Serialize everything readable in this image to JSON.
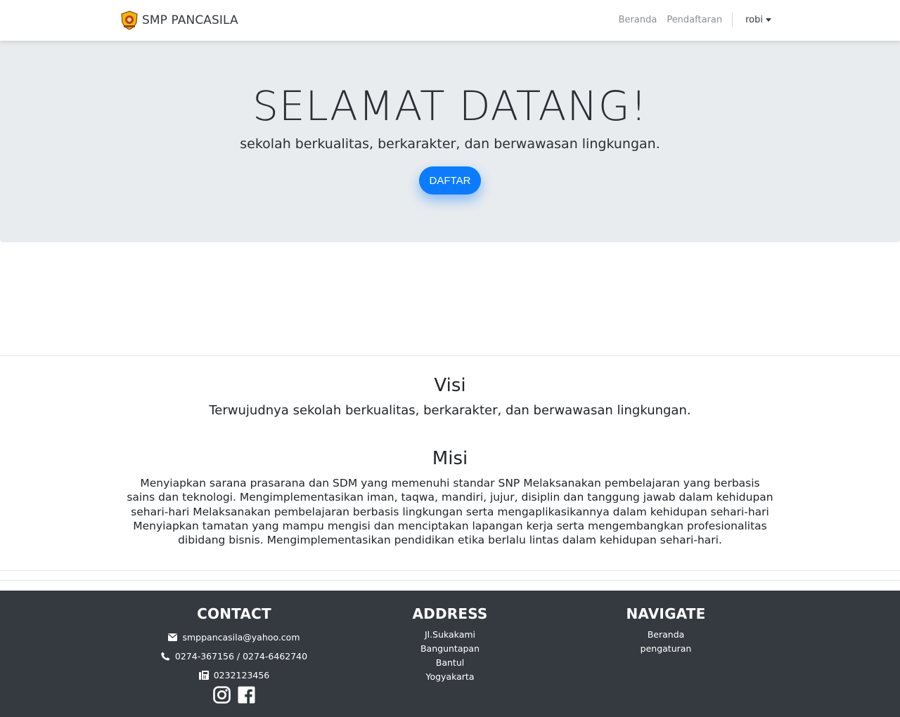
{
  "navbar": {
    "brand": "SMP PANCASILA",
    "links": [
      "Beranda",
      "Pendaftaran"
    ],
    "user": "robi"
  },
  "hero": {
    "title": "SELAMAT DATANG!",
    "subtitle": "sekolah berkualitas, berkarakter, dan berwawasan lingkungan.",
    "button": "DAFTAR"
  },
  "visi": {
    "title": "Visi",
    "text": "Terwujudnya sekolah berkualitas, berkarakter, dan berwawasan lingkungan."
  },
  "misi": {
    "title": "Misi",
    "text": "Menyiapkan sarana prasarana dan SDM yang memenuhi standar SNP Melaksanakan pembelajaran yang berbasis sains dan teknologi. Mengimplementasikan iman, taqwa, mandiri, jujur, disiplin dan tanggung jawab dalam kehidupan sehari-hari Melaksanakan pembelajaran berbasis lingkungan serta mengaplikasikannya dalam kehidupan sehari-hari Menyiapkan tamatan yang mampu mengisi dan menciptakan lapangan kerja serta mengembangkan profesionalitas dibidang bisnis. Mengimplementasikan pendidikan etika berlalu lintas dalam kehidupan sehari-hari."
  },
  "footer": {
    "contact": {
      "title": "CONTACT",
      "email": "smppancasila@yahoo.com",
      "phone": "0274-367156 / 0274-6462740",
      "fax": "0232123456"
    },
    "address": {
      "title": "ADDRESS",
      "lines": [
        "Jl.Sukakami",
        "Banguntapan",
        "Bantul",
        "Yogyakarta"
      ]
    },
    "navigate": {
      "title": "NAVIGATE",
      "links": [
        "Beranda",
        "pengaturan"
      ]
    }
  },
  "colors": {
    "primary": "#0b7cff",
    "hero_bg": "#e9ecef",
    "footer_bg": "#343a40"
  }
}
